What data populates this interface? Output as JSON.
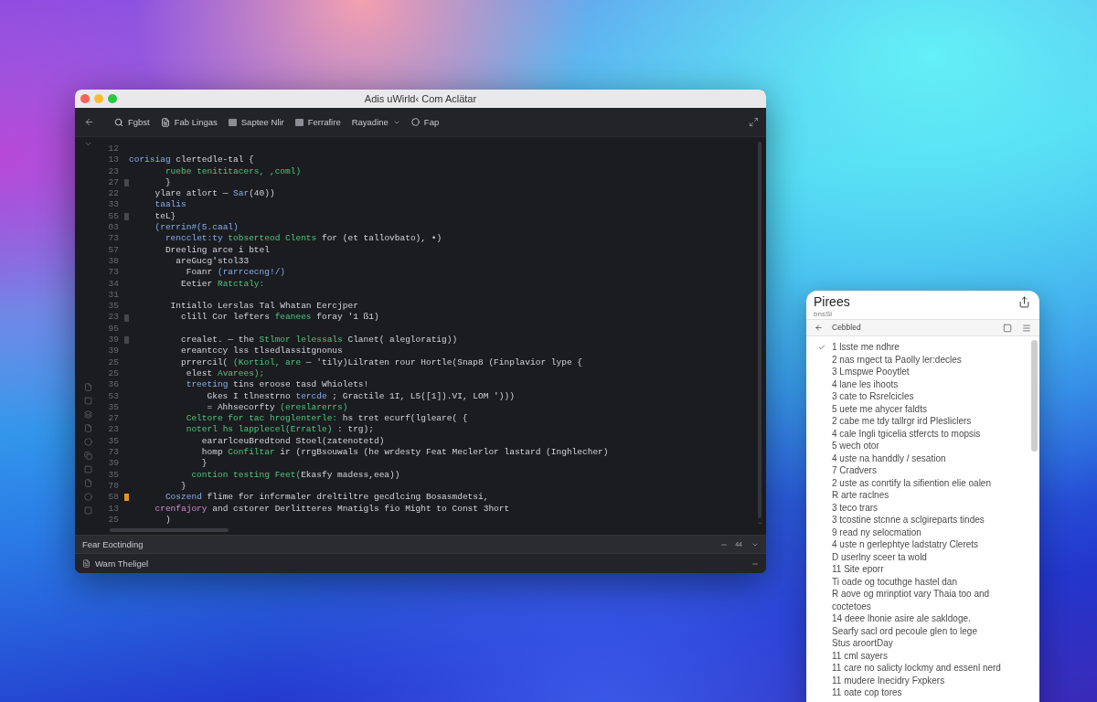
{
  "editor_window": {
    "title": "Adis uWirld‹ Com Aclätar",
    "toolbar": [
      {
        "label": "Fgbst",
        "kind": "icon"
      },
      {
        "label": "Fab Lingas",
        "kind": "icon"
      },
      {
        "label": "Saptee Nlir",
        "kind": "icon"
      },
      {
        "label": "Ferrafire",
        "kind": "icon"
      },
      {
        "label": "Rayadine",
        "kind": "menu"
      },
      {
        "label": "Fap",
        "kind": "icon"
      }
    ],
    "lines": [
      {
        "number": "12"
      },
      {
        "number": "13",
        "tokens": [
          {
            "kind": "keyword",
            "text": "corisiag"
          },
          {
            "kind": "plain",
            "text": " clertedle-tal {"
          }
        ]
      },
      {
        "number": "23",
        "tokens": [
          {
            "kind": "string",
            "text": "       ruebe tenititacers, ,coml)"
          }
        ]
      },
      {
        "number": "27",
        "color": "#45474d",
        "tokens": [
          {
            "kind": "plain",
            "text": "       }"
          }
        ]
      },
      {
        "number": "22",
        "tokens": [
          {
            "kind": "plain",
            "text": "     ylare atlort — "
          },
          {
            "kind": "keyword",
            "text": "Sar"
          },
          {
            "kind": "plain",
            "text": "(40))"
          }
        ]
      },
      {
        "number": "33",
        "tokens": [
          {
            "kind": "keyword",
            "text": "     taalis"
          }
        ]
      },
      {
        "number": "55",
        "color": "#45474d",
        "tokens": [
          {
            "kind": "plain",
            "text": "     teL}"
          }
        ]
      },
      {
        "number": "03",
        "tokens": [
          {
            "kind": "keyword",
            "text": "     (rerrin#(5.caal)"
          }
        ]
      },
      {
        "number": "73",
        "tokens": [
          {
            "kind": "keyword",
            "text": "       rencclet:ty "
          },
          {
            "kind": "string",
            "text": "tobserteod Clents"
          },
          {
            "kind": "plain",
            "text": " for (et tallovbato), •)"
          }
        ]
      },
      {
        "number": "57",
        "tokens": [
          {
            "kind": "plain",
            "text": "       Dreeling arce i btel"
          }
        ]
      },
      {
        "number": "38",
        "tokens": [
          {
            "kind": "plain",
            "text": "         areGucg'stol33"
          }
        ]
      },
      {
        "number": "73",
        "tokens": [
          {
            "kind": "plain",
            "text": "           Foanr "
          },
          {
            "kind": "keyword",
            "text": "(rarrcecng!/)"
          }
        ]
      },
      {
        "number": "34",
        "tokens": [
          {
            "kind": "plain",
            "text": "          Eetier "
          },
          {
            "kind": "string",
            "text": "Ratctaly:"
          }
        ]
      },
      {
        "number": "31"
      },
      {
        "number": "35",
        "tokens": [
          {
            "kind": "plain",
            "text": "        Intiallo Lerslas Tal Whatan Eercjper"
          }
        ]
      },
      {
        "number": "23",
        "color": "#45474d",
        "tokens": [
          {
            "kind": "plain",
            "text": "          clill Cor lefters "
          },
          {
            "kind": "string",
            "text": "feanees"
          },
          {
            "kind": "plain",
            "text": " foray '1 ß1)"
          }
        ]
      },
      {
        "number": "95"
      },
      {
        "number": "39",
        "color": "#45474d",
        "tokens": [
          {
            "kind": "plain",
            "text": "          crealet. — the "
          },
          {
            "kind": "string",
            "text": "Stlmor lelessals"
          },
          {
            "kind": "plain",
            "text": " Clanet( alegloratig))"
          }
        ]
      },
      {
        "number": "39",
        "tokens": [
          {
            "kind": "plain",
            "text": "          ereantccy lss tlsedlassitgnonus"
          }
        ]
      },
      {
        "number": "25",
        "tokens": [
          {
            "kind": "plain",
            "text": "          prrercil( "
          },
          {
            "kind": "string",
            "text": "(Kortiol, are"
          },
          {
            "kind": "plain",
            "text": " — 'tily)Lilraten rour Hortle(Snap8 (Finplavior lype {"
          }
        ]
      },
      {
        "number": "25",
        "tokens": [
          {
            "kind": "plain",
            "text": "           elest "
          },
          {
            "kind": "string",
            "text": "Avarees);"
          }
        ]
      },
      {
        "number": "36",
        "tokens": [
          {
            "kind": "keyword",
            "text": "           treeting"
          },
          {
            "kind": "plain",
            "text": " tins eroose tasd Whiolets!"
          }
        ]
      },
      {
        "number": "53",
        "tokens": [
          {
            "kind": "plain",
            "text": "               Gkes I tlnestrno "
          },
          {
            "kind": "keyword",
            "text": "tercde"
          },
          {
            "kind": "plain",
            "text": " ; Gractile 1I, L5([1]).VI, LOM ')))"
          }
        ]
      },
      {
        "number": "35",
        "tokens": [
          {
            "kind": "plain",
            "text": "               = Ahhsecorfty "
          },
          {
            "kind": "string",
            "text": "(ereslarerrs)"
          }
        ]
      },
      {
        "number": "27",
        "tokens": [
          {
            "kind": "string",
            "text": "           Celtore for tac hroglenterle:"
          },
          {
            "kind": "plain",
            "text": " hs tret ecurf(lgleare( {"
          }
        ]
      },
      {
        "number": "23",
        "tokens": [
          {
            "kind": "string",
            "text": "           noterl hs lapplecel(Erratle)"
          },
          {
            "kind": "plain",
            "text": " : trg);"
          }
        ]
      },
      {
        "number": "35",
        "tokens": [
          {
            "kind": "plain",
            "text": "              eararlceuBredtond Stoel(zatenotetd)"
          }
        ]
      },
      {
        "number": "73",
        "tokens": [
          {
            "kind": "plain",
            "text": "              homp "
          },
          {
            "kind": "string",
            "text": "Confiltar"
          },
          {
            "kind": "plain",
            "text": " ir (rrgBsouwals (he wrdesty Feat Meclerlor lastard (Inghlecher)"
          }
        ]
      },
      {
        "number": "39",
        "tokens": [
          {
            "kind": "plain",
            "text": "              }"
          }
        ]
      },
      {
        "number": "35",
        "tokens": [
          {
            "kind": "string",
            "text": "            contion testing Feet("
          },
          {
            "kind": "plain",
            "text": "Ekasfy madess,eea))"
          }
        ]
      },
      {
        "number": "70",
        "tokens": [
          {
            "kind": "plain",
            "text": "          }"
          }
        ]
      },
      {
        "number": "58",
        "color": "#e8922a",
        "tokens": [
          {
            "kind": "keyword",
            "text": "       Coszend"
          },
          {
            "kind": "plain",
            "text": " flime for infcrmaler dreltiltre gecdlcing Bosasmdetsi,"
          }
        ]
      },
      {
        "number": "13",
        "tokens": [
          {
            "kind": "special",
            "text": "     crenfajory"
          },
          {
            "kind": "plain",
            "text": " and cstorer Derlitteres Mnatigls fio Might to Const 3hort"
          }
        ]
      },
      {
        "number": "25",
        "tokens": [
          {
            "kind": "plain",
            "text": "       )"
          }
        ]
      }
    ],
    "panels": [
      {
        "kind": "header",
        "title": "Fear Eoctinding",
        "count": "44"
      },
      {
        "kind": "file",
        "title": "Warn Theligel"
      }
    ]
  },
  "side_panel": {
    "title": "Pirees",
    "subtitle": "bnsSi",
    "nav_label": "Cebbled",
    "items": [
      {
        "text": "1 lsste me ndhre",
        "checked": true
      },
      {
        "text": "2 nas rngect ta Paolly ler:decles",
        "checked": false
      },
      {
        "text": "3 Lmspwe Pooytlet",
        "checked": false
      },
      {
        "text": "4 lane les ihoots",
        "checked": false
      },
      {
        "text": "3 cate to Rsrelcicles",
        "checked": false
      },
      {
        "text": "5 uete me ahycer faldts",
        "checked": false
      },
      {
        "text": "2 cabe me tdy tallrgr ird Plesliclers",
        "checked": false
      },
      {
        "text": "4 cale Ingli tgicelia stfercts to mopsis",
        "checked": false
      },
      {
        "text": "5 wech otor",
        "checked": false
      },
      {
        "text": "4 uste na handdly / sesation",
        "checked": false
      },
      {
        "text": "7 Cradvers",
        "checked": false
      },
      {
        "text": "2 uste as conrtify la sifiention elie oalen",
        "checked": false
      },
      {
        "text": "R arte raclnes",
        "checked": false
      },
      {
        "text": "3 teco trars",
        "checked": false
      },
      {
        "text": "3 tcostine stcnne a sclgireparts tindes",
        "checked": false
      },
      {
        "text": "9 read ny selocmation",
        "checked": false
      },
      {
        "text": "4 uste n gerlephtye ladstatry Clerets",
        "checked": false
      },
      {
        "text": "D userlny sceer ta wold",
        "checked": false
      },
      {
        "text": "11 Site eporr",
        "checked": false
      },
      {
        "text": "Ti oade og tocuthge hastel dan",
        "checked": false
      },
      {
        "text": "R aove og mrinptiot vary Thaia too and coctetoes",
        "checked": false
      },
      {
        "text": "14 deee lhonie asire ale sakldoge.",
        "checked": false
      },
      {
        "text": "Searfy sacl ord pecoule glen to lege",
        "checked": false
      },
      {
        "text": "Stus aroortDay",
        "checked": false
      },
      {
        "text": "11 cml sayers",
        "checked": false
      },
      {
        "text": "11 care no salicty lockmy and essenl nerd",
        "checked": false
      },
      {
        "text": "11 mudere Inecidry Fxpkers",
        "checked": false
      },
      {
        "text": "11 oate cop tores",
        "checked": false
      }
    ]
  }
}
